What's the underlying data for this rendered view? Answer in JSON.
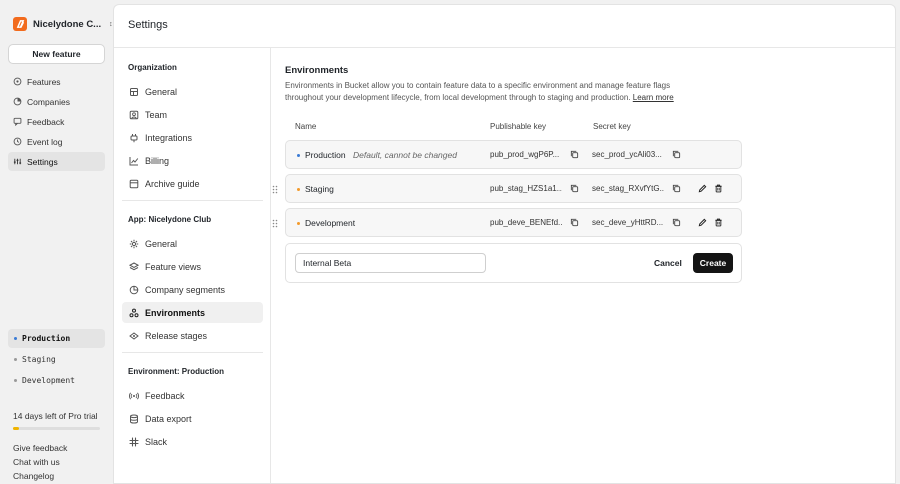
{
  "org": {
    "name": "Nicelydone C...",
    "logo_icon": "bucket-logo-icon",
    "brand_color": "#f26b1d"
  },
  "sidebar": {
    "new_feature_label": "New feature",
    "nav": [
      {
        "label": "Features",
        "icon": "features-icon"
      },
      {
        "label": "Companies",
        "icon": "companies-icon"
      },
      {
        "label": "Feedback",
        "icon": "feedback-icon"
      },
      {
        "label": "Event log",
        "icon": "event-log-icon"
      },
      {
        "label": "Settings",
        "icon": "settings-icon",
        "active": true
      }
    ],
    "environments": [
      {
        "label": "Production",
        "active": true,
        "color": "#3a7bd5"
      },
      {
        "label": "Staging"
      },
      {
        "label": "Development"
      }
    ],
    "trial": {
      "text": "14 days left of Pro trial",
      "progress": 0.07
    },
    "footer_links": [
      "Give feedback",
      "Chat with us",
      "Changelog"
    ]
  },
  "main": {
    "title": "Settings",
    "settings_nav": {
      "sections": [
        {
          "heading": "Organization",
          "items": [
            "General",
            "Team",
            "Integrations",
            "Billing",
            "Archive guide"
          ]
        },
        {
          "heading": "App: Nicelydone Club",
          "items": [
            "General",
            "Feature views",
            "Company segments",
            "Environments",
            "Release stages"
          ]
        },
        {
          "heading": "Environment: Production",
          "items": [
            "Feedback",
            "Data export",
            "Slack"
          ]
        }
      ],
      "active": "Environments"
    },
    "content": {
      "title": "Environments",
      "description": "Environments in Bucket allow you to contain feature data to a specific environment and manage feature flags throughout your development lifecycle, from local development through to staging and production.",
      "learn_more": "Learn more",
      "columns": {
        "name": "Name",
        "publishable_key": "Publishable key",
        "secret_key": "Secret key"
      },
      "rows": [
        {
          "name": "Production",
          "note": "Default, cannot be changed",
          "color": "#3a7bd5",
          "publishable_key": "pub_prod_wgP6P...",
          "secret_key": "sec_prod_ycAli03...",
          "editable": false
        },
        {
          "name": "Staging",
          "note": "",
          "color": "#f39a2b",
          "publishable_key": "pub_stag_HZS1a1...",
          "secret_key": "sec_stag_RXvfYtG...",
          "editable": true
        },
        {
          "name": "Development",
          "note": "",
          "color": "#f39a2b",
          "publishable_key": "pub_deve_BENEfd...",
          "secret_key": "sec_deve_yHttRD...",
          "editable": true
        }
      ],
      "new_env": {
        "value": "Internal Beta",
        "cancel_label": "Cancel",
        "create_label": "Create"
      }
    }
  }
}
